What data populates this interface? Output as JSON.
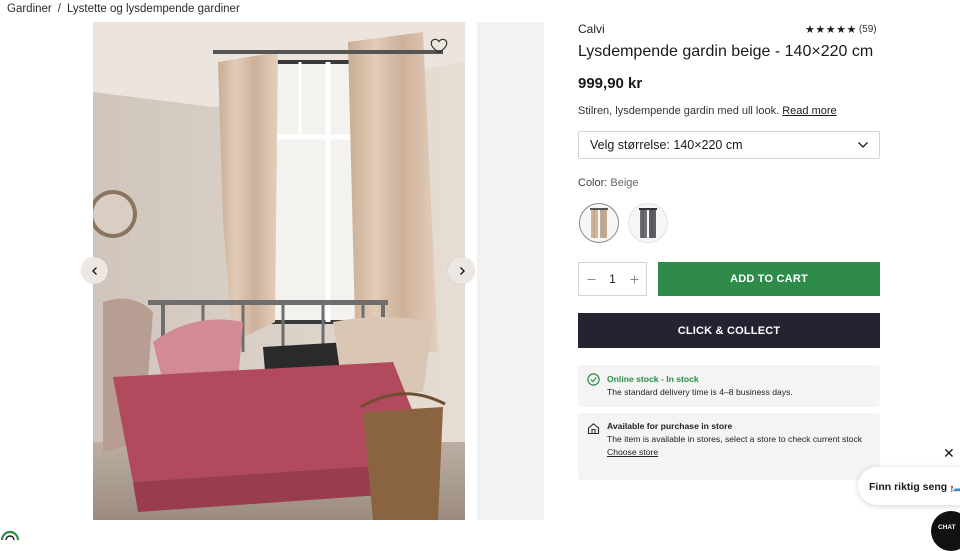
{
  "breadcrumb": [
    "Gardiner",
    "/",
    "Lystette og lysdempende gardiner"
  ],
  "product": {
    "brand": "Calvi",
    "rating_count": "(59)",
    "rating_value": 5,
    "title": "Lysdempende gardin beige - 140×220 cm",
    "price": "999,90 kr",
    "short_desc": "Stilren, lysdempende gardin med ull look.",
    "read_more": "Read more",
    "size_select": "Velg størrelse: 140×220 cm",
    "color_label": "Color:",
    "color_value": "Beige",
    "swatches": [
      "Beige",
      "Grey"
    ],
    "quantity": "1"
  },
  "buttons": {
    "add_to_cart": "ADD TO CART",
    "click_collect": "CLICK & COLLECT"
  },
  "stock": {
    "head": "Online stock - In stock",
    "body": "The standard delivery time is 4–8 business days."
  },
  "store": {
    "head": "Available for purchase in store",
    "body": "The item is available in stores, select a store to check current stock",
    "link": "Choose store"
  },
  "chat": {
    "close": "✕",
    "bubble": "Finn riktig seng 🛏️",
    "button": "CHAT"
  },
  "colors": {
    "cart_green": "#2e8b4a",
    "collect_dark": "#252232",
    "stock_green": "#2e8b4a"
  }
}
